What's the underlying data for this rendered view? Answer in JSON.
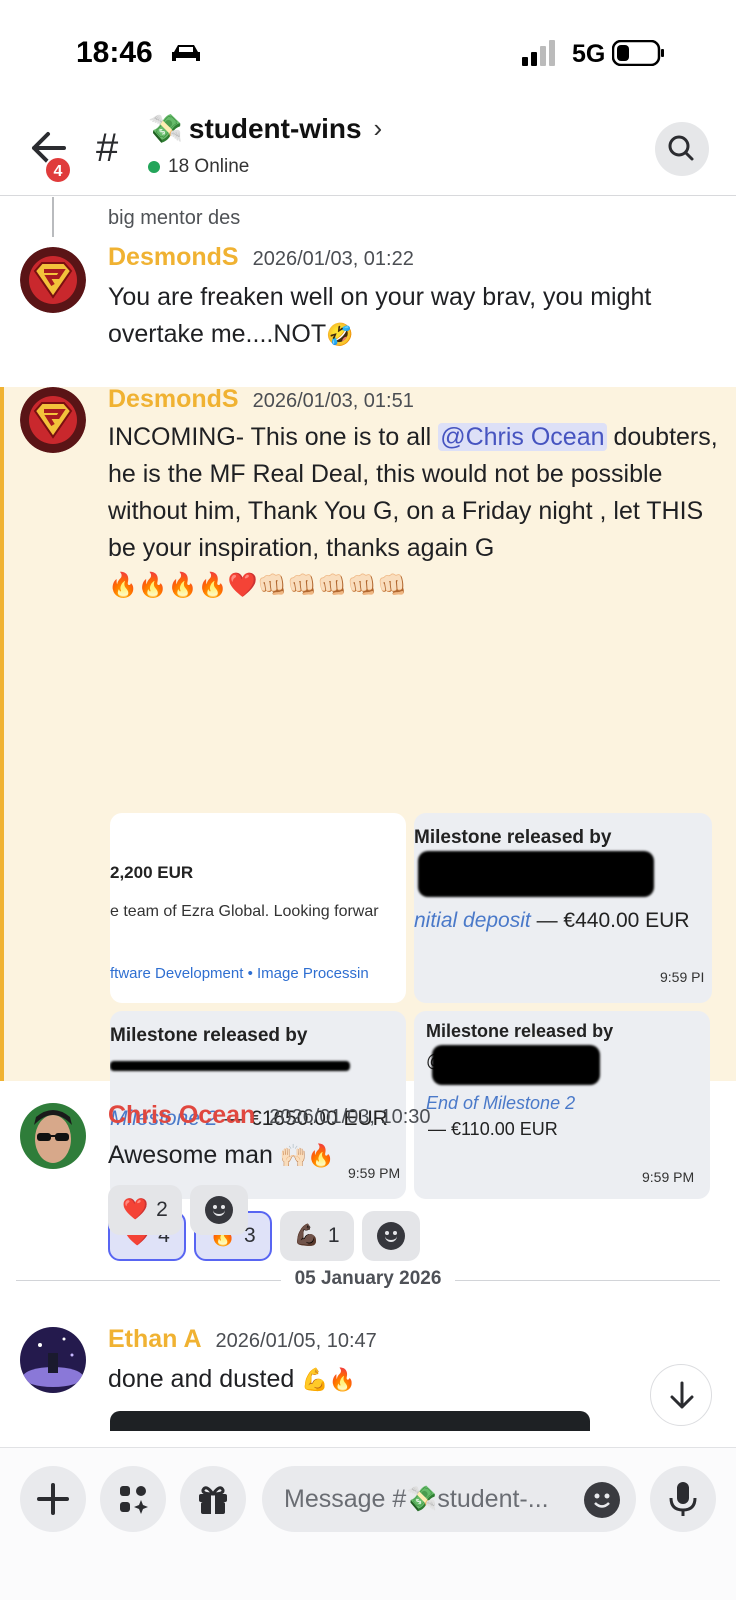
{
  "status_bar": {
    "time": "18:46",
    "network": "5G"
  },
  "header": {
    "unread_badge": "4",
    "hash": "#",
    "channel_emoji": "💸",
    "channel_name": "student-wins",
    "chevron": "›",
    "online": "18 Online"
  },
  "feed": {
    "reply_preview": "big mentor des",
    "messages": [
      {
        "author": "DesmondS",
        "author_color": "#f0b232",
        "timestamp": "2026/01/03, 01:22",
        "text": "You are freaken well on your way brav, you might overtake me....NOT",
        "emoji": "🤣"
      },
      {
        "author": "DesmondS",
        "author_color": "#f0b232",
        "timestamp": "2026/01/03, 01:51",
        "text_before": "INCOMING- This one is to all ",
        "mention": "@Chris Ocean",
        "text_after": " doubters, he is the MF Real Deal,  this would not be possible without him, Thank You G, on a Friday night , let THIS be your inspiration, thanks again G",
        "emoji_line": "🔥🔥🔥🔥❤️👊🏻👊🏻👊🏻👊🏻👊🏻",
        "images": [
          {
            "line1": "2,200 EUR",
            "line2": "e team of Ezra Global. Looking forwar",
            "line3": "ftware Development  •  Image Processin"
          },
          {
            "title": "Milestone released by",
            "link": "nitial deposit",
            "amount": " — €440.00 EUR",
            "time": "9:59 PI"
          },
          {
            "title": "Milestone released by",
            "link": "Milestone 2",
            "amount": " — €1650.00 EUR",
            "time": "9:59 PM"
          },
          {
            "title": "Milestone released by",
            "at": "@",
            "link": "End of Milestone 2",
            "amount": "— €110.00 EUR",
            "time": "9:59 PM"
          }
        ],
        "reactions": [
          {
            "emoji": "❤️",
            "count": "4",
            "me": true
          },
          {
            "emoji": "🔥",
            "count": "3",
            "me": true
          },
          {
            "emoji": "💪🏿",
            "count": "1",
            "me": false
          }
        ]
      },
      {
        "author": "Chris Ocean",
        "author_color": "#e0473f",
        "timestamp": "2026/01/03, 10:30",
        "text": "Awesome man",
        "emoji": "🙌🏻🔥",
        "reactions": [
          {
            "emoji": "❤️",
            "count": "2",
            "me": false
          }
        ]
      }
    ],
    "date_divider": "05 January 2026",
    "last_message": {
      "author": "Ethan A",
      "author_color": "#f0b232",
      "timestamp": "2026/01/05, 10:47",
      "text": "done and dusted ",
      "emoji": "💪🔥"
    }
  },
  "composer": {
    "placeholder": "Message #💸student-..."
  }
}
